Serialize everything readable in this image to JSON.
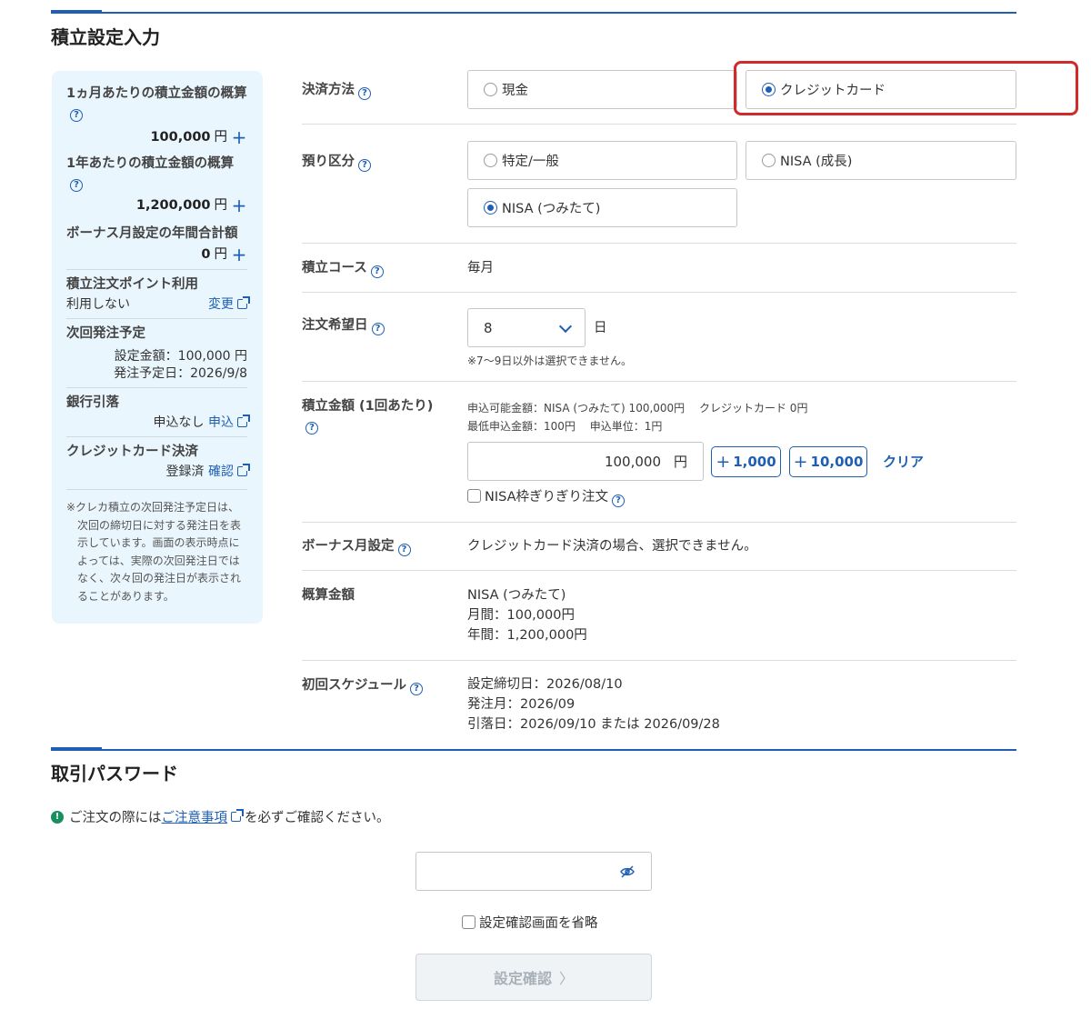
{
  "section1": {
    "title": "積立設定入力"
  },
  "summary": {
    "monthly_label": "1ヵ月あたりの積立金額の概算",
    "monthly_value": "100,000",
    "yearly_label": "1年あたりの積立金額の概算",
    "yearly_value": "1,200,000",
    "bonus_label": "ボーナス月設定の年間合計額",
    "bonus_value": "0",
    "unit": "円",
    "points_label": "積立注文ポイント利用",
    "points_value": "利用しない",
    "points_link": "変更",
    "next_label": "次回発注予定",
    "next_amount": "設定金額：100,000 円",
    "next_date": "発注予定日：2026/9/8",
    "bank_label": "銀行引落",
    "bank_value": "申込なし",
    "bank_link": "申込",
    "card_label": "クレジットカード決済",
    "card_value": "登録済",
    "card_link": "確認",
    "note": "※クレカ積立の次回発注予定日は、次回の締切日に対する発注日を表示しています。画面の表示時点によっては、実際の次回発注日ではなく、次々回の発注日が表示されることがあります。"
  },
  "form": {
    "payment_label": "決済方法",
    "payment_options": [
      "現金",
      "クレジットカード"
    ],
    "payment_selected": "クレジットカード",
    "account_label": "預り区分",
    "account_options": [
      "特定/一般",
      "NISA (成長)",
      "NISA (つみたて)"
    ],
    "account_selected": "NISA (つみたて)",
    "course_label": "積立コース",
    "course_value": "毎月",
    "order_day_label": "注文希望日",
    "order_day_value": "8",
    "order_day_unit": "日",
    "order_day_note": "※7〜9日以外は選択できません。",
    "amount_label": "積立金額 (1回あたり)",
    "amount_info1": "申込可能金額：NISA (つみたて) 100,000円　 クレジットカード 0円",
    "amount_info2": "最低申込金額：100円　 申込単位：1円",
    "amount_value": "100,000",
    "amount_unit": "円",
    "inc1": "1,000",
    "inc2": "10,000",
    "clear": "クリア",
    "nisa_check": "NISA枠ぎりぎり注文",
    "bonus_label": "ボーナス月設定",
    "bonus_value": "クレジットカード決済の場合、選択できません。",
    "estimate_label": "概算金額",
    "estimate_lines": [
      "NISA (つみたて)",
      "月間：100,000円",
      "年間：1,200,000円"
    ],
    "schedule_label": "初回スケジュール",
    "schedule_lines": [
      "設定締切日：2026/08/10",
      "発注月：2026/09",
      "引落日：2026/09/10 または 2026/09/28"
    ]
  },
  "section2": {
    "title": "取引パスワード",
    "notice_pre": "ご注文の際には",
    "notice_link": "ご注意事項",
    "notice_post": "を必ずご確認ください。",
    "password_value": "",
    "skip_label": "設定確認画面を省略",
    "confirm_label": "設定確認"
  },
  "colors": {
    "accent": "#1f5fb3",
    "highlight": "#d22a2a",
    "panel": "#eaf6fd"
  }
}
